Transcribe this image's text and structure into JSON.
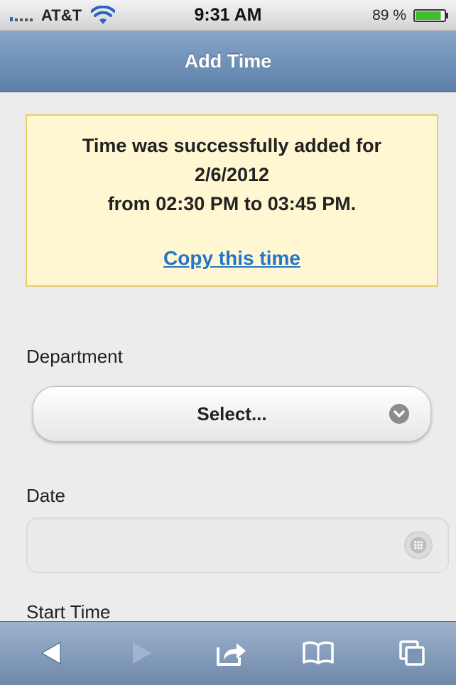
{
  "status_bar": {
    "carrier": "AT&T",
    "time": "9:31 AM",
    "battery": "89 %",
    "battery_level": 0.89
  },
  "header": {
    "title": "Add Time"
  },
  "notice": {
    "line1": "Time was successfully added for",
    "line2": "2/6/2012",
    "line3": "from 02:30 PM to 03:45 PM.",
    "link": "Copy this time",
    "background_color": "#fff7d1",
    "border_color": "#e5cd69",
    "link_color": "#2476c8"
  },
  "form": {
    "department": {
      "label": "Department",
      "selected": "Select..."
    },
    "date": {
      "label": "Date",
      "value": ""
    },
    "start_time": {
      "label": "Start Time"
    }
  },
  "toolbar": {
    "icons": [
      "back-icon",
      "forward-icon",
      "share-icon",
      "bookmarks-icon",
      "pages-icon"
    ]
  }
}
